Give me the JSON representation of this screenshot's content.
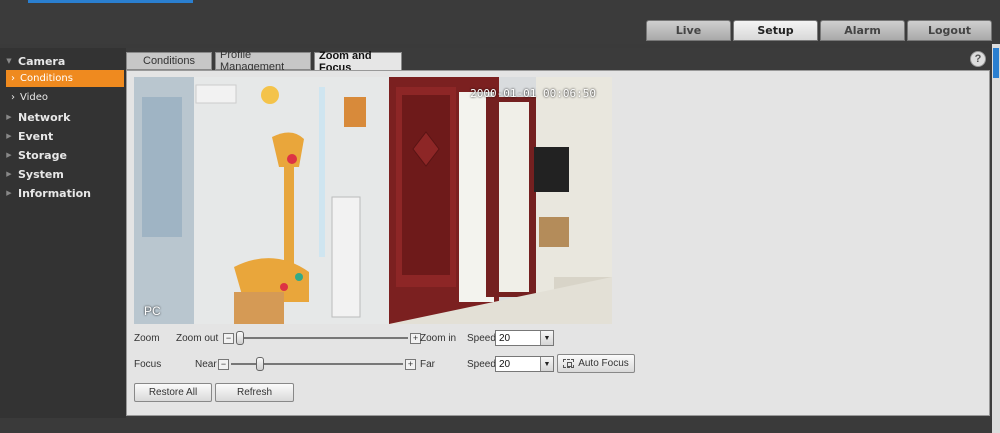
{
  "topnav": {
    "tabs": [
      {
        "label": "Live",
        "active": false
      },
      {
        "label": "Setup",
        "active": true
      },
      {
        "label": "Alarm",
        "active": false
      },
      {
        "label": "Logout",
        "active": false
      }
    ]
  },
  "sidebar": {
    "camera": "Camera",
    "conditions": "Conditions",
    "video": "Video",
    "network": "Network",
    "event": "Event",
    "storage": "Storage",
    "system": "System",
    "information": "Information",
    "active_color": "#ef8a1f"
  },
  "subtabs": {
    "conditions": "Conditions",
    "profile": "Profile Management",
    "zoom_focus": "Zoom and Focus"
  },
  "help_glyph": "?",
  "video": {
    "timestamp": "2000-01-01 00:06:50",
    "cam_label": "PC"
  },
  "zoom": {
    "label": "Zoom",
    "out_label": "Zoom out",
    "in_label": "Zoom in",
    "minus": "−",
    "plus": "+",
    "level": 0.0,
    "speed_label": "Speed",
    "speed_value": "20"
  },
  "focus": {
    "label": "Focus",
    "near_label": "Near",
    "far_label": "Far",
    "minus": "−",
    "plus": "+",
    "level": 0.15,
    "speed_label": "Speed",
    "speed_value": "20",
    "auto_focus": "Auto Focus"
  },
  "buttons": {
    "restore_all": "Restore All",
    "refresh": "Refresh"
  }
}
